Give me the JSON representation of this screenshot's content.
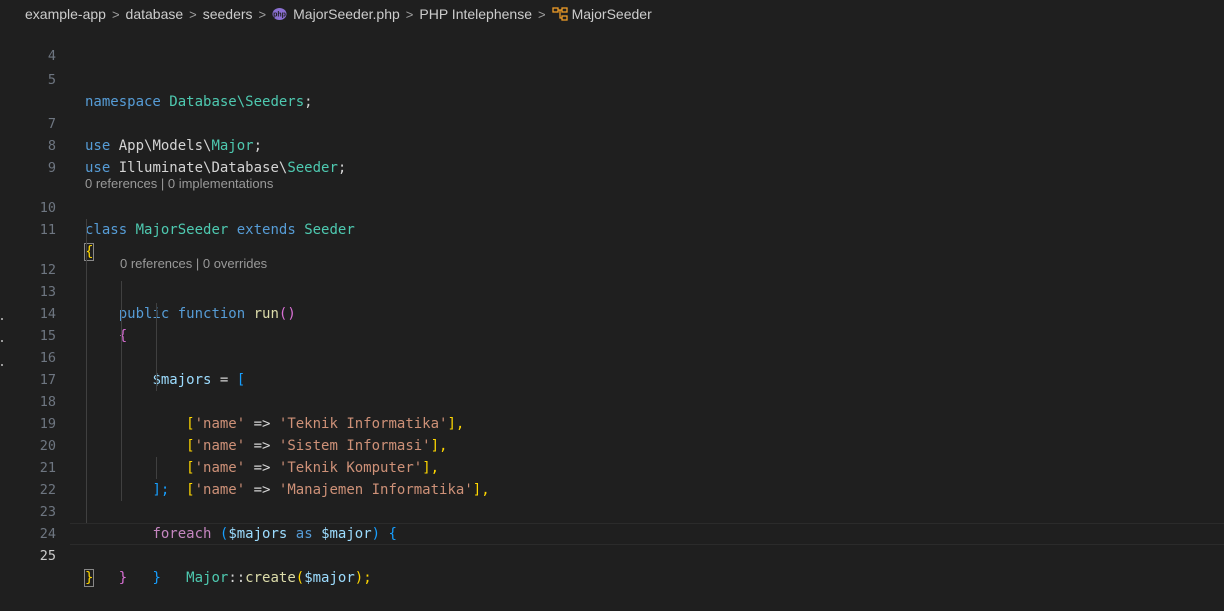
{
  "breadcrumb": {
    "items": [
      {
        "label": "example-app"
      },
      {
        "label": "database"
      },
      {
        "label": "seeders"
      },
      {
        "label": "MajorSeeder.php",
        "icon": "php-file-icon"
      },
      {
        "label": "PHP Intelephense"
      },
      {
        "label": "MajorSeeder",
        "icon": "class-symbol-icon"
      }
    ],
    "separator": ">"
  },
  "codelens": {
    "class_refs": "0 references | 0 implementations",
    "method_refs": "0 references | 0 overrides"
  },
  "editor": {
    "line_numbers": [
      "4",
      "5",
      "7",
      "8",
      "9",
      "10",
      "11",
      "12",
      "13",
      "14",
      "15",
      "16",
      "17",
      "18",
      "19",
      "20",
      "21",
      "22",
      "23",
      "24",
      "25"
    ],
    "tokens": {
      "namespace_kw": "namespace",
      "namespace_path": "Database\\Seeders",
      "semi": ";",
      "use_kw": "use",
      "use1_path": "App\\Models\\",
      "use1_class": "Major",
      "use2_path": "Illuminate\\Database\\",
      "use2_class": "Seeder",
      "class_kw": "class",
      "class_name": "MajorSeeder",
      "extends_kw": "extends",
      "parent_class": "Seeder",
      "brace_open": "{",
      "brace_close": "}",
      "public_kw": "public",
      "function_kw": "function",
      "method_name": "run",
      "paren_pair": "()",
      "majors_var": "$majors",
      "assign": " = ",
      "bracket_open": "[",
      "bracket_close_semi": "];",
      "name_key": "'name'",
      "arrow": " => ",
      "rows": [
        "'Teknik Informatika'",
        "'Sistem Informasi'",
        "'Teknik Komputer'",
        "'Manajemen Informatika'"
      ],
      "row_end": "],",
      "foreach_kw": "foreach",
      "paren_open": "(",
      "paren_close": ")",
      "as_kw": " as ",
      "major_var": "$major",
      "major_class": "Major",
      "scope_op": "::",
      "create_fn": "create",
      "call_end": ");"
    }
  },
  "colors": {
    "background": "#1f1f1f",
    "keyword": "#569cd6",
    "control": "#c586c0",
    "type": "#4ec9b0",
    "function": "#dcdcaa",
    "variable": "#9cdcfe",
    "string": "#ce9178"
  }
}
